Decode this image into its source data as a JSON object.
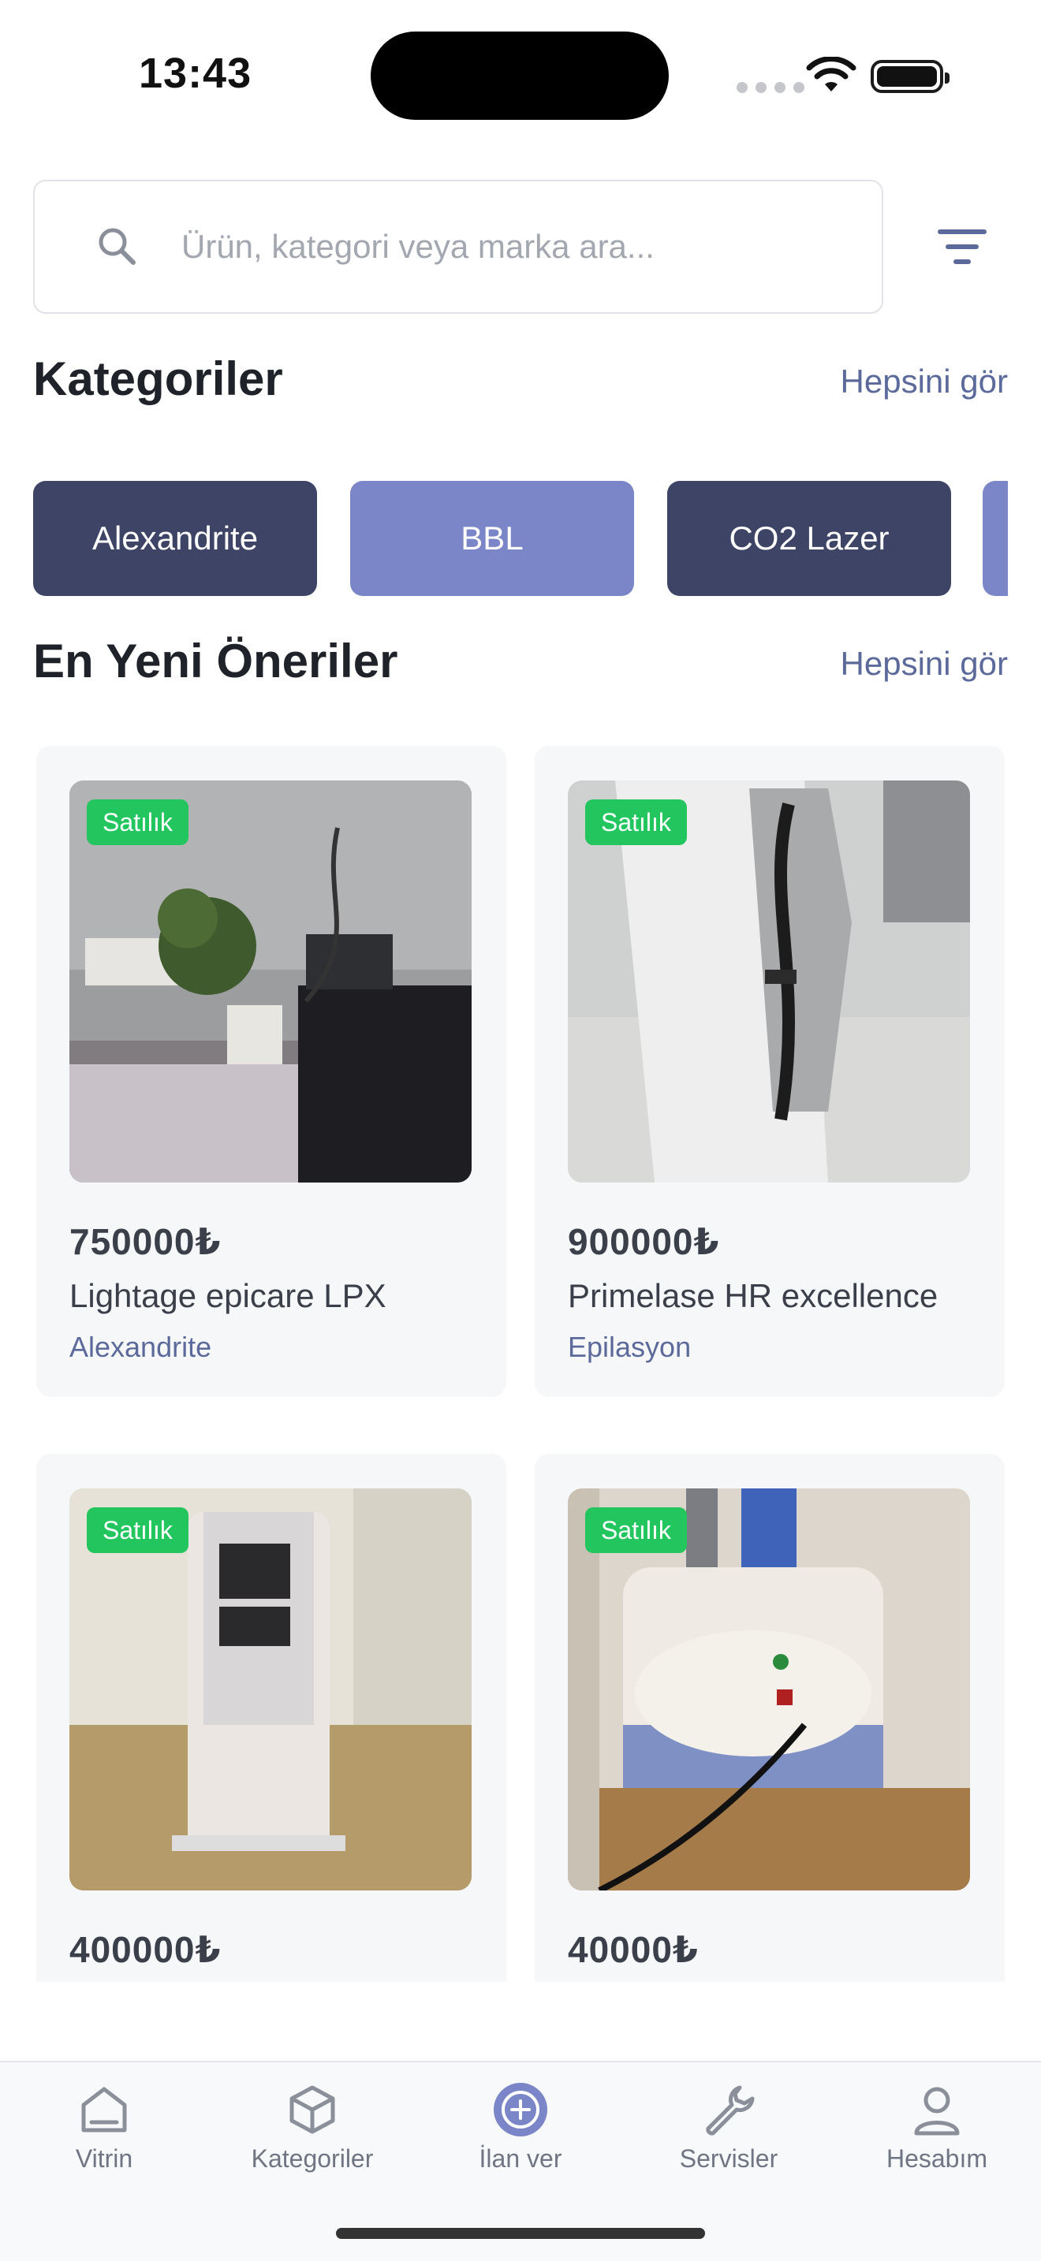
{
  "status": {
    "time": "13:43"
  },
  "search": {
    "placeholder": "Ürün, kategori veya marka ara..."
  },
  "categories_section": {
    "title": "Kategoriler",
    "see_all": "Hepsini gör"
  },
  "categories": [
    {
      "label": "Alexandrite",
      "style": "dark"
    },
    {
      "label": "BBL",
      "style": "light"
    },
    {
      "label": "CO2 Lazer",
      "style": "dark"
    },
    {
      "label": "",
      "style": "light"
    }
  ],
  "newest_section": {
    "title": "En Yeni Öneriler",
    "see_all": "Hepsini gör"
  },
  "products": [
    {
      "badge": "Satılık",
      "price": "750000₺",
      "name": "Lightage epicare LPX",
      "category": "Alexandrite"
    },
    {
      "badge": "Satılık",
      "price": "900000₺",
      "name": "Primelase HR excellence",
      "category": "Epilasyon"
    },
    {
      "badge": "Satılık",
      "price": "400000₺",
      "name": "",
      "category": ""
    },
    {
      "badge": "Satılık",
      "price": "40000₺",
      "name": "",
      "category": ""
    }
  ],
  "tabs": [
    {
      "label": "Vitrin",
      "icon": "home-icon"
    },
    {
      "label": "Kategoriler",
      "icon": "box-icon"
    },
    {
      "label": "İlan ver",
      "icon": "plus-circle-icon"
    },
    {
      "label": "Servisler",
      "icon": "wrench-icon"
    },
    {
      "label": "Hesabım",
      "icon": "user-icon"
    }
  ],
  "colors": {
    "chip_dark": "#3e4466",
    "chip_light": "#7a86c7",
    "badge_green": "#22c55e",
    "accent_text": "#5b6a9a"
  }
}
